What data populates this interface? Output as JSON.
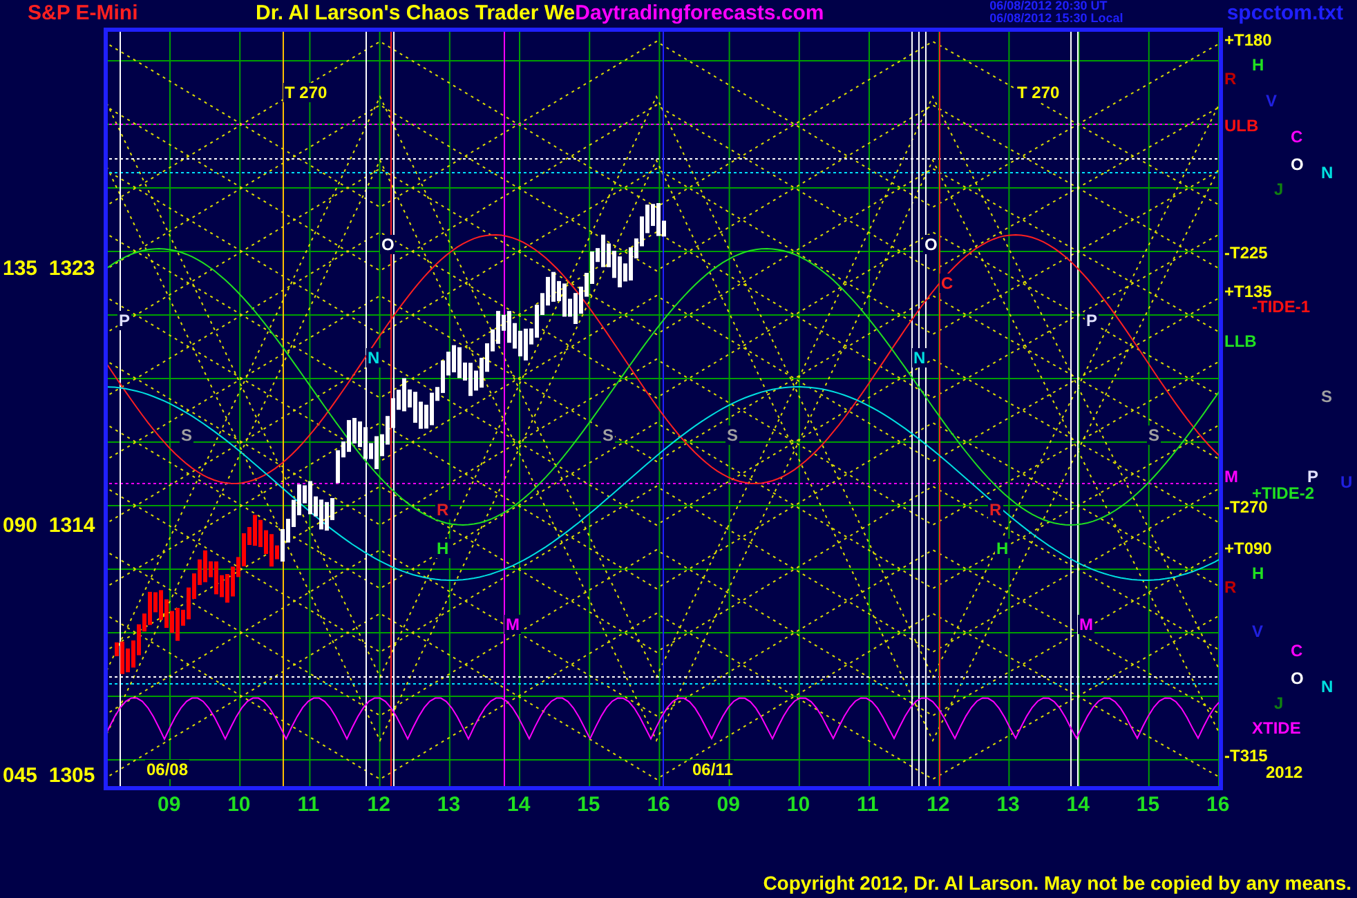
{
  "header": {
    "symbol": "S&P E-Mini",
    "title": "Dr. Al Larson's Chaos Trader We",
    "site": "Daytradingforecasts.com",
    "time_ut": "06/08/2012 20:30 UT",
    "time_local": "06/08/2012 15:30 Local",
    "file": "spcctom.txt"
  },
  "y_axis": [
    "135  1323",
    "090  1314",
    "045  1305"
  ],
  "x_axis": [
    "09",
    "10",
    "11",
    "12",
    "13",
    "14",
    "15",
    "16",
    "09",
    "10",
    "11",
    "12",
    "13",
    "14",
    "15",
    "16"
  ],
  "chart_labels": [
    {
      "text": "T  270",
      "color": "#ffff00"
    },
    {
      "text": "T  270",
      "color": "#ffff00"
    },
    {
      "text": "O",
      "color": "#ffffff"
    },
    {
      "text": "O",
      "color": "#ffffff"
    },
    {
      "text": "C",
      "color": "#ff2020"
    },
    {
      "text": "P",
      "color": "#e0e0ff"
    },
    {
      "text": "P",
      "color": "#e0e0ff"
    },
    {
      "text": "N",
      "color": "#00e0e0"
    },
    {
      "text": "N",
      "color": "#00e0e0"
    },
    {
      "text": "S",
      "color": "#a0a0a0"
    },
    {
      "text": "S",
      "color": "#a0a0a0"
    },
    {
      "text": "S",
      "color": "#a0a0a0"
    },
    {
      "text": "S",
      "color": "#a0a0a0"
    },
    {
      "text": "R",
      "color": "#e02020"
    },
    {
      "text": "R",
      "color": "#e02020"
    },
    {
      "text": "H",
      "color": "#20e020"
    },
    {
      "text": "H",
      "color": "#20e020"
    },
    {
      "text": "M",
      "color": "#ff00ff"
    },
    {
      "text": "M",
      "color": "#ff00ff"
    },
    {
      "text": "06/08",
      "color": "#ffff00"
    },
    {
      "text": "06/11",
      "color": "#ffff00"
    }
  ],
  "right_labels": [
    {
      "text": "+T180",
      "color": "#ffff00"
    },
    {
      "text": "H",
      "color": "#20e020"
    },
    {
      "text": "R",
      "color": "#c00000"
    },
    {
      "text": "V",
      "color": "#2020e0"
    },
    {
      "text": "ULB",
      "color": "#ff1010"
    },
    {
      "text": "C",
      "color": "#ff00ff"
    },
    {
      "text": "O",
      "color": "#ffffff"
    },
    {
      "text": "N",
      "color": "#00e0e0"
    },
    {
      "text": "J",
      "color": "#108010"
    },
    {
      "text": "-T225",
      "color": "#ffff00"
    },
    {
      "text": "+T135",
      "color": "#ffff00"
    },
    {
      "text": "-TIDE-1",
      "color": "#ff1010"
    },
    {
      "text": "LLB",
      "color": "#20e020"
    },
    {
      "text": "S",
      "color": "#a0a0a0"
    },
    {
      "text": "M",
      "color": "#ff00ff"
    },
    {
      "text": "P",
      "color": "#e0e0ff"
    },
    {
      "text": "U",
      "color": "#2020e0"
    },
    {
      "text": "+TIDE-2",
      "color": "#20e020"
    },
    {
      "text": "-T270",
      "color": "#ffff00"
    },
    {
      "text": "+T090",
      "color": "#ffff00"
    },
    {
      "text": "H",
      "color": "#20e020"
    },
    {
      "text": "R",
      "color": "#c00000"
    },
    {
      "text": "V",
      "color": "#2020e0"
    },
    {
      "text": "C",
      "color": "#ff00ff"
    },
    {
      "text": "O",
      "color": "#ffffff"
    },
    {
      "text": "N",
      "color": "#00e0e0"
    },
    {
      "text": "J",
      "color": "#108010"
    },
    {
      "text": "XTIDE",
      "color": "#ff00ff"
    },
    {
      "text": "-T315",
      "color": "#ffff00"
    },
    {
      "text": "2012",
      "color": "#ffff00"
    }
  ],
  "copyright": "Copyright 2012, Dr. Al Larson. May not be copied by any means."
}
